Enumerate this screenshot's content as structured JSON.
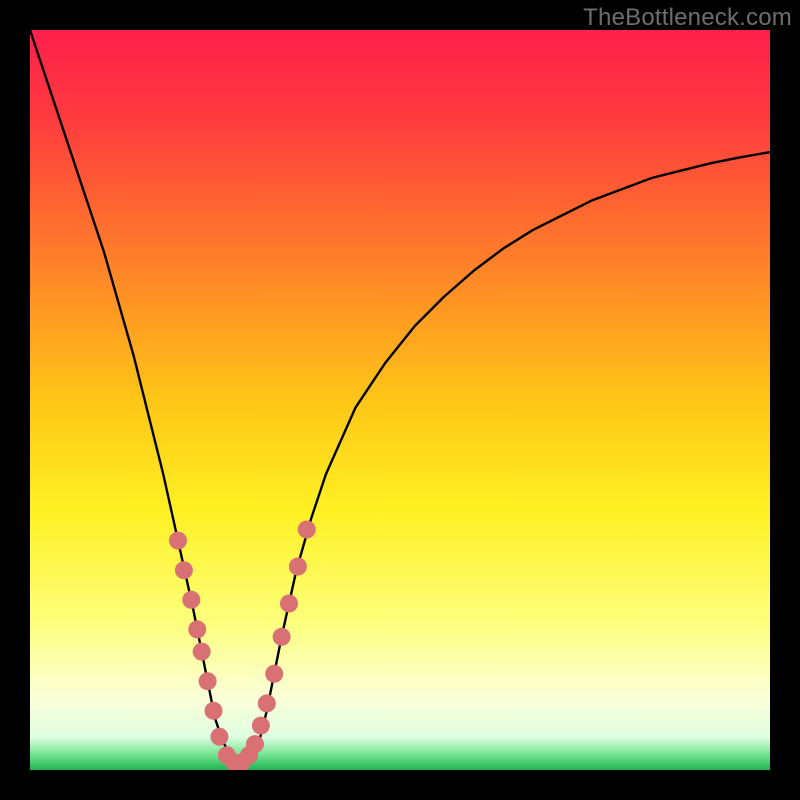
{
  "watermark": "TheBottleneck.com",
  "chart_data": {
    "type": "line",
    "title": "",
    "xlabel": "",
    "ylabel": "",
    "xlim": [
      0,
      100
    ],
    "ylim": [
      0,
      100
    ],
    "background_gradient": {
      "stops": [
        {
          "offset": 0.0,
          "color": "#ff1f4b"
        },
        {
          "offset": 0.12,
          "color": "#ff3b3f"
        },
        {
          "offset": 0.3,
          "color": "#ff7b2a"
        },
        {
          "offset": 0.5,
          "color": "#ffc617"
        },
        {
          "offset": 0.65,
          "color": "#fff123"
        },
        {
          "offset": 0.8,
          "color": "#fdff7c"
        },
        {
          "offset": 0.9,
          "color": "#fbffd6"
        },
        {
          "offset": 0.955,
          "color": "#dfffe2"
        },
        {
          "offset": 0.98,
          "color": "#71e38f"
        },
        {
          "offset": 1.0,
          "color": "#1fb454"
        }
      ]
    },
    "series": [
      {
        "name": "bottleneck-curve",
        "x": [
          0,
          2,
          4,
          6,
          8,
          10,
          12,
          14,
          16,
          18,
          20,
          22,
          23,
          24,
          25,
          26,
          27,
          28,
          29,
          30,
          31,
          32,
          33,
          34,
          36,
          38,
          40,
          44,
          48,
          52,
          56,
          60,
          64,
          68,
          72,
          76,
          80,
          84,
          88,
          92,
          96,
          100
        ],
        "y": [
          100,
          94,
          88,
          82,
          76,
          70,
          63,
          56,
          48,
          40,
          31,
          22,
          17,
          12,
          7,
          4,
          2,
          1,
          1,
          2,
          4,
          8,
          13,
          18,
          27,
          34,
          40,
          49,
          55,
          60,
          64,
          67.5,
          70.5,
          73,
          75,
          77,
          78.5,
          80,
          81,
          82,
          82.8,
          83.5
        ]
      }
    ],
    "markers": {
      "name": "highlight-dots",
      "color": "#d97074",
      "radius": 9,
      "points": [
        {
          "x": 20.0,
          "y": 31.0
        },
        {
          "x": 20.8,
          "y": 27.0
        },
        {
          "x": 21.8,
          "y": 23.0
        },
        {
          "x": 22.6,
          "y": 19.0
        },
        {
          "x": 23.2,
          "y": 16.0
        },
        {
          "x": 24.0,
          "y": 12.0
        },
        {
          "x": 24.8,
          "y": 8.0
        },
        {
          "x": 25.6,
          "y": 4.5
        },
        {
          "x": 26.6,
          "y": 2.0
        },
        {
          "x": 27.6,
          "y": 1.0
        },
        {
          "x": 28.6,
          "y": 1.0
        },
        {
          "x": 29.6,
          "y": 2.0
        },
        {
          "x": 30.4,
          "y": 3.5
        },
        {
          "x": 31.2,
          "y": 6.0
        },
        {
          "x": 32.0,
          "y": 9.0
        },
        {
          "x": 33.0,
          "y": 13.0
        },
        {
          "x": 34.0,
          "y": 18.0
        },
        {
          "x": 35.0,
          "y": 22.5
        },
        {
          "x": 36.2,
          "y": 27.5
        },
        {
          "x": 37.4,
          "y": 32.5
        }
      ]
    }
  }
}
